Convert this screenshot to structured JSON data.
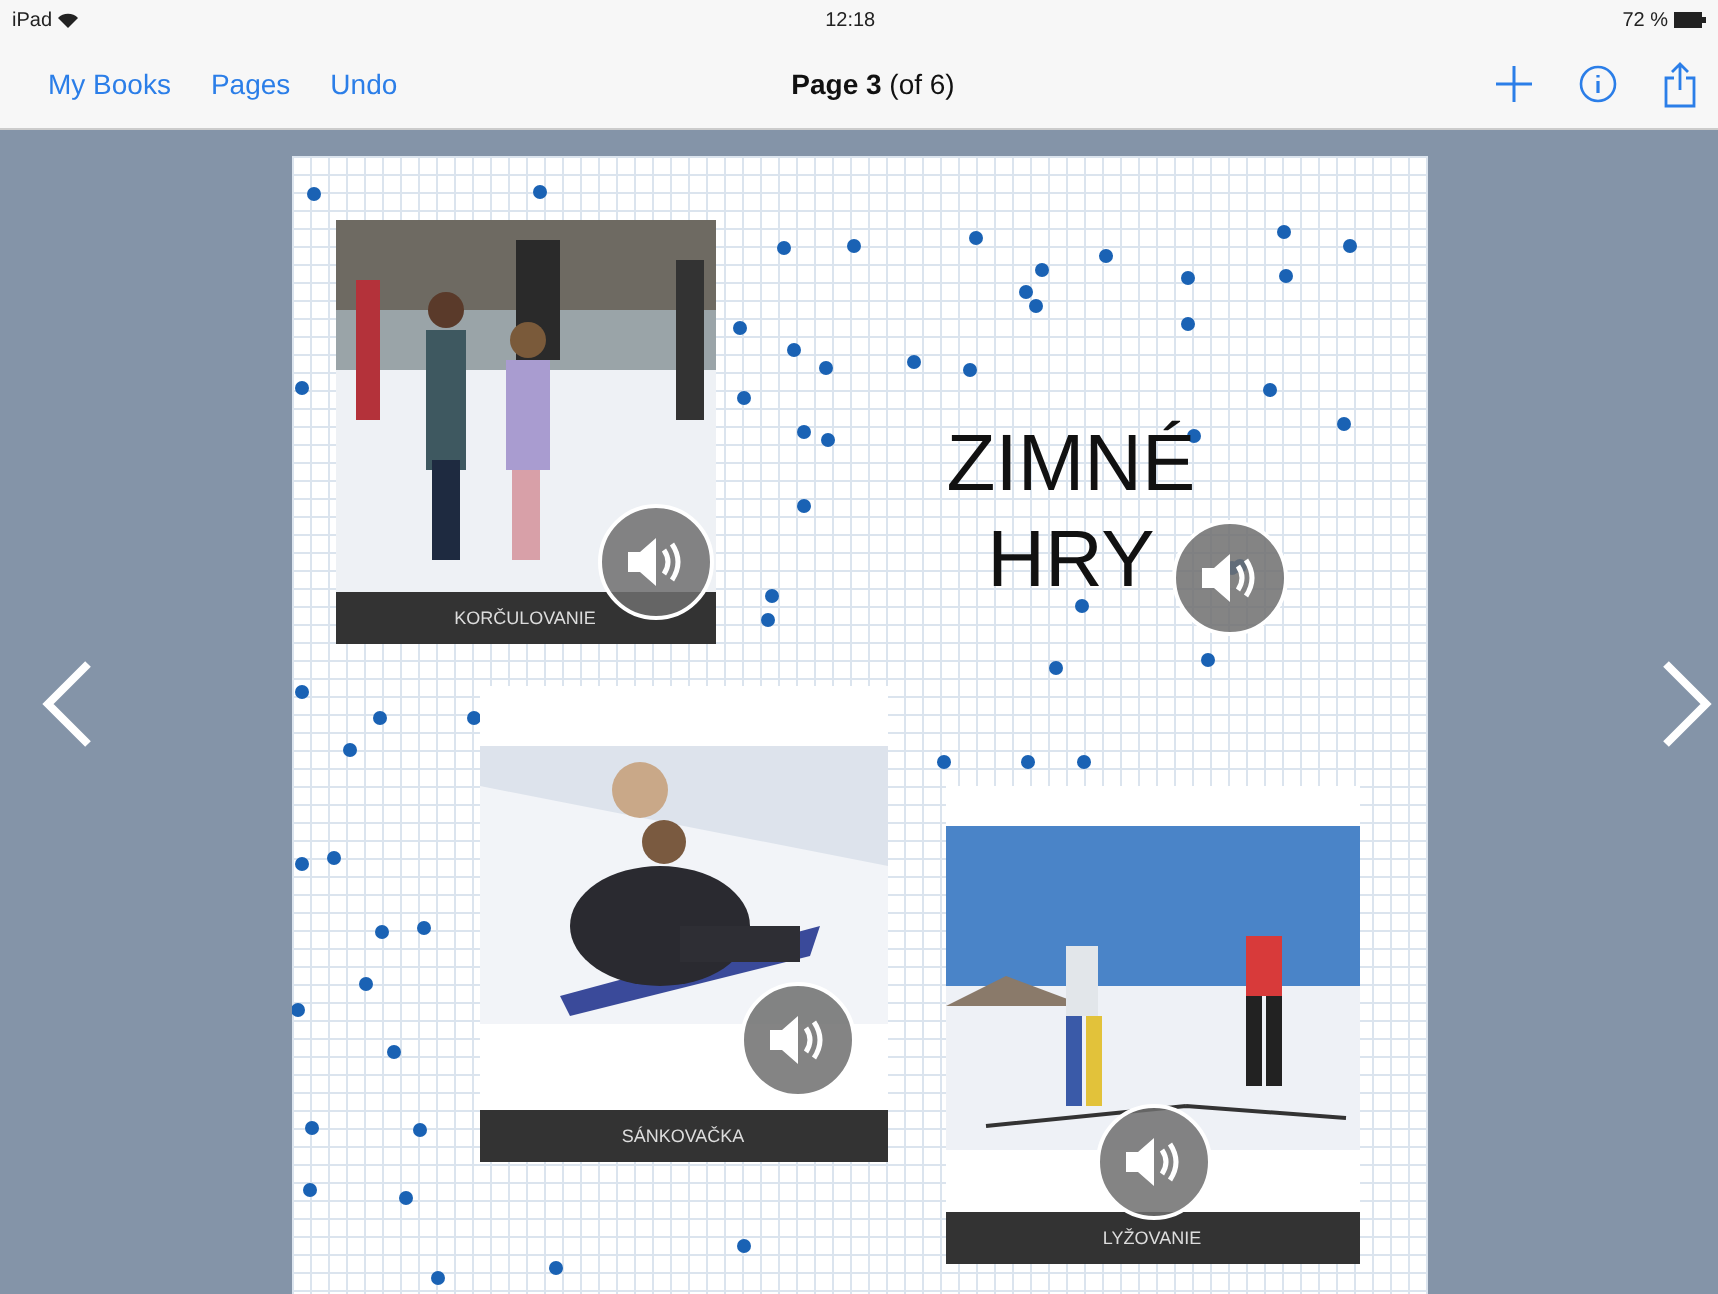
{
  "status_bar": {
    "device": "iPad",
    "time": "12:18",
    "battery": "72 %"
  },
  "nav_bar": {
    "left_buttons": [
      "My Books",
      "Pages",
      "Undo"
    ],
    "title": "**Page 3** (of 6)"
  },
  "page": {
    "heading": [
      "ZIMNÉ",
      "HRY"
    ],
    "cards": [
      {
        "caption": "KORČULOVANIE",
        "kind": "picture"
      },
      {
        "caption": "SÁNKOVAČKA",
        "kind": "picture"
      },
      {
        "caption": "LYŽOVANIE",
        "kind": "picture"
      }
    ]
  }
}
